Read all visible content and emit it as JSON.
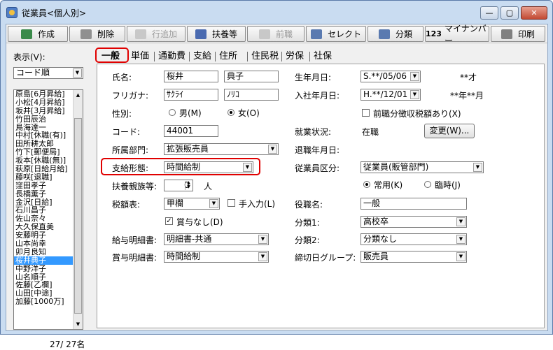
{
  "window": {
    "title": "従業員<個人別>",
    "minimize": "—",
    "maximize": "▢",
    "close": "✕"
  },
  "toolbar": [
    {
      "label": "作成",
      "icon": "create-icon",
      "disabled": false
    },
    {
      "label": "削除",
      "icon": "trash-icon",
      "disabled": false
    },
    {
      "label": "行追加",
      "icon": "grid-icon",
      "disabled": true
    },
    {
      "label": "扶養等",
      "icon": "family-icon",
      "disabled": false
    },
    {
      "label": "前職",
      "icon": "doc-icon",
      "disabled": true
    },
    {
      "label": "セレクト",
      "icon": "select-icon",
      "disabled": false
    },
    {
      "label": "分類",
      "icon": "category-icon",
      "disabled": false
    },
    {
      "label": "マイナンバー",
      "icon": "mynumber-icon",
      "disabled": false,
      "prefix": "123"
    },
    {
      "label": "印刷",
      "icon": "print-icon",
      "disabled": false
    }
  ],
  "left": {
    "display_label": "表示(V):",
    "sort_value": "コード順",
    "employees": [
      "原島[6月昇給]",
      "小松[4月昇給]",
      "坂井[3月昇給]",
      "竹田辰治",
      "鳥海達一",
      "中村[休職(有)]",
      "田所耕太郎",
      "竹下[郵便局]",
      "坂本[休職(無)]",
      "萩原[日給月給]",
      "藤咲[退職]",
      "窪田孝子",
      "長橋薫子",
      "金沢[日給]",
      "石川昌子",
      "佐山奈々",
      "大久保直美",
      "安藤明子",
      "山本尚幸",
      "卯月良知",
      "桜井典子",
      "中野洋子",
      "山名順子",
      "佐藤[乙欄]",
      "山田[中途]",
      "加藤[1000万]"
    ],
    "selected_index": 20,
    "count": "27/ 27名"
  },
  "tabs": [
    "一般",
    "単価",
    "通勤費",
    "支給",
    "住所",
    "住民税",
    "労保",
    "社保"
  ],
  "form": {
    "name_label": "氏名:",
    "last_name": "桜井",
    "first_name": "典子",
    "kana_label": "フリガナ:",
    "last_kana": "ｻｸﾗｲ",
    "first_kana": "ﾉﾘｺ",
    "gender_label": "性別:",
    "male": "男(M)",
    "female": "女(O)",
    "code_label": "コード:",
    "code": "44001",
    "dept_label": "所属部門:",
    "dept": "拡張販売員",
    "pay_form_label": "支給形態:",
    "pay_form": "時間給制",
    "dependents_label": "扶養親族等:",
    "dependents": "0",
    "dependents_unit": "人",
    "tax_table_label": "税額表:",
    "tax_table": "甲欄",
    "manual_input": "手入力(L)",
    "no_bonus": "賞与なし(D)",
    "payslip_label": "給与明細書:",
    "payslip": "明細書-共通",
    "bonus_slip_label": "賞与明細書:",
    "bonus_slip": "時間給制",
    "birth_label": "生年月日:",
    "birth": "S.**/05/06",
    "age": "**才",
    "hire_label": "入社年月日:",
    "hire": "H.**/12/01",
    "tenure": "**年**月",
    "prev_job_tax": "前職分徴収税額あり(X)",
    "status_label": "就業状況:",
    "status": "在職",
    "change_button": "変更(W)...",
    "retire_label": "退職年月日:",
    "emp_class_label": "従業員区分:",
    "emp_class": "従業員(販管部門)",
    "regular": "常用(K)",
    "temporary": "臨時(J)",
    "position_label": "役職名:",
    "position": "一般",
    "class1_label": "分類1:",
    "class1": "高校卒",
    "class2_label": "分類2:",
    "class2": "分類なし",
    "closing_group_label": "締切日グループ:",
    "closing_group": "販売員"
  }
}
